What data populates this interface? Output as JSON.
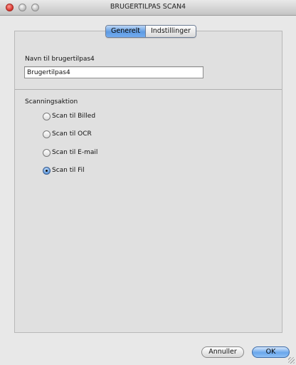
{
  "window": {
    "title": "BRUGERTILPAS SCAN4"
  },
  "tabs": [
    {
      "label": "Generelt",
      "active": true
    },
    {
      "label": "Indstillinger",
      "active": false
    }
  ],
  "name_section": {
    "label": "Navn til brugertilpas4",
    "value": "Brugertilpas4"
  },
  "scan_action": {
    "label": "Scanningsaktion",
    "options": [
      {
        "label": "Scan til Billed",
        "checked": false
      },
      {
        "label": "Scan til OCR",
        "checked": false
      },
      {
        "label": "Scan til E-mail",
        "checked": false
      },
      {
        "label": "Scan til Fil",
        "checked": true
      }
    ]
  },
  "buttons": {
    "cancel": "Annuller",
    "ok": "OK"
  },
  "colors": {
    "accent": "#5e9be2",
    "close_button": "#d4302a"
  }
}
